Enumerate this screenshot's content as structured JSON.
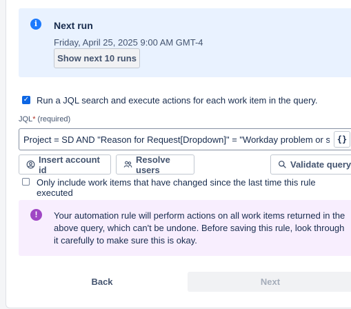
{
  "next_run": {
    "title": "Next run",
    "date": "Friday, April 25, 2025 9:00 AM GMT-4",
    "show_button": "Show next 10 runs"
  },
  "jql_option": {
    "label": "Run a JQL search and execute actions for each work item in the query.",
    "checked": true
  },
  "jql": {
    "label": "JQL",
    "required_mark": "*",
    "required_text": "(required)",
    "value": "Project = SD AND \"Reason for Request[Dropdown]\" = \"Workday problem or sug",
    "braces_label": "{}"
  },
  "actions": {
    "insert_account": "Insert account id",
    "resolve_users": "Resolve users",
    "validate_query": "Validate query"
  },
  "only_changed": {
    "label": "Only include work items that have changed since the last time this rule executed",
    "checked": false
  },
  "warning": {
    "text": "Your automation rule will perform actions on all work items returned in the above query, which can't be undone. Before saving this rule, look through it carefully to make sure this is okay."
  },
  "footer": {
    "back": "Back",
    "next": "Next"
  },
  "colors": {
    "info_bg": "#e9f2ff",
    "info_icon": "#1d7afc",
    "warning_bg": "#f8eefe",
    "warning_icon": "#9f46c4",
    "checkbox": "#0c66e4"
  }
}
